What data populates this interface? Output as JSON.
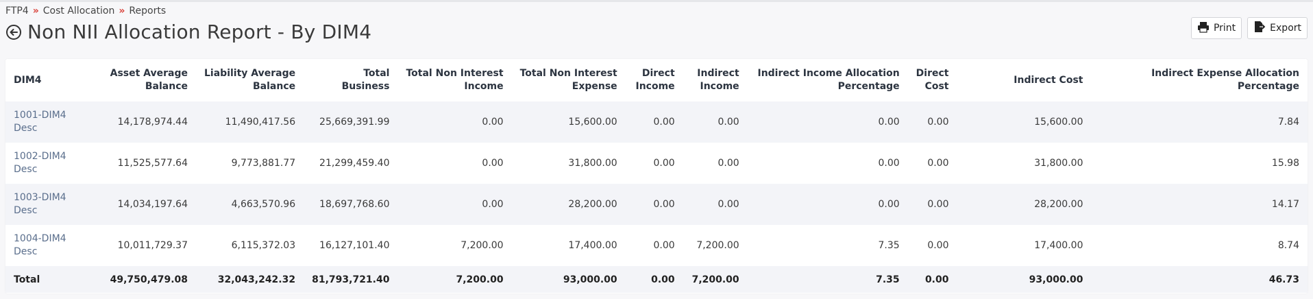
{
  "breadcrumb": [
    "FTP4",
    "Cost Allocation",
    "Reports"
  ],
  "breadcrumb_separator": "»",
  "page_title": "Non NII Allocation Report - By DIM4",
  "actions": {
    "print_label": "Print",
    "export_label": "Export"
  },
  "table": {
    "headers": [
      [
        "DIM4",
        ""
      ],
      [
        "Asset Average",
        "Balance"
      ],
      [
        "Liability Average",
        "Balance"
      ],
      [
        "Total",
        "Business"
      ],
      [
        "Total Non Interest",
        "Income"
      ],
      [
        "Total Non Interest",
        "Expense"
      ],
      [
        "Direct",
        "Income"
      ],
      [
        "Indirect",
        "Income"
      ],
      [
        "Indirect Income Allocation",
        "Percentage"
      ],
      [
        "Direct",
        "Cost"
      ],
      [
        "Indirect Cost",
        ""
      ],
      [
        "Indirect Expense Allocation",
        "Percentage"
      ]
    ],
    "rows": [
      [
        [
          "1001-DIM4",
          "Desc"
        ],
        "14,178,974.44",
        "11,490,417.56",
        "25,669,391.99",
        "0.00",
        "15,600.00",
        "0.00",
        "0.00",
        "0.00",
        "0.00",
        "15,600.00",
        "7.84"
      ],
      [
        [
          "1002-DIM4",
          "Desc"
        ],
        "11,525,577.64",
        "9,773,881.77",
        "21,299,459.40",
        "0.00",
        "31,800.00",
        "0.00",
        "0.00",
        "0.00",
        "0.00",
        "31,800.00",
        "15.98"
      ],
      [
        [
          "1003-DIM4",
          "Desc"
        ],
        "14,034,197.64",
        "4,663,570.96",
        "18,697,768.60",
        "0.00",
        "28,200.00",
        "0.00",
        "0.00",
        "0.00",
        "0.00",
        "28,200.00",
        "14.17"
      ],
      [
        [
          "1004-DIM4",
          "Desc"
        ],
        "10,011,729.37",
        "6,115,372.03",
        "16,127,101.40",
        "7,200.00",
        "17,400.00",
        "0.00",
        "7,200.00",
        "7.35",
        "0.00",
        "17,400.00",
        "8.74"
      ]
    ],
    "total": [
      "Total",
      "49,750,479.08",
      "32,043,242.32",
      "81,793,721.40",
      "7,200.00",
      "93,000.00",
      "0.00",
      "7,200.00",
      "7.35",
      "0.00",
      "93,000.00",
      "46.73"
    ]
  },
  "icons": {
    "back": "back-arrow-circle-icon",
    "print": "printer-icon",
    "export": "export-file-icon"
  },
  "colors": {
    "separator": "#d9423a",
    "dim_link": "#5a6e8c",
    "stripe": "#f3f4f8"
  }
}
